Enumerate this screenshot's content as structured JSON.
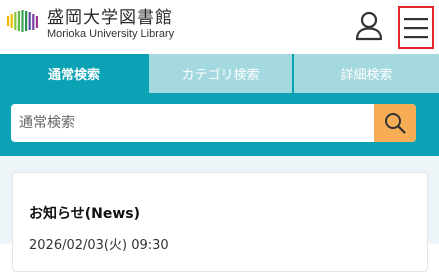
{
  "header": {
    "logo_title": "盛岡大学図書館",
    "logo_subtitle": "Morioka University Library",
    "logo_colors": [
      "#f4b400",
      "#8cc63f",
      "#3aa655",
      "#7b3fa0"
    ],
    "user_icon": "user-icon",
    "menu_icon": "hamburger-menu-icon",
    "menu_highlight_color": "#e3262d"
  },
  "search": {
    "tabs": [
      {
        "label": "通常検索",
        "active": true
      },
      {
        "label": "カテゴリ検索",
        "active": false
      },
      {
        "label": "詳細検索",
        "active": false
      }
    ],
    "placeholder": "通常検索",
    "value": "",
    "button_icon": "search-icon",
    "panel_color": "#0aa2b4",
    "button_color": "#f7ad55"
  },
  "news": {
    "title": "お知らせ(News)",
    "first_date": "2026/02/03(火) 09:30"
  }
}
